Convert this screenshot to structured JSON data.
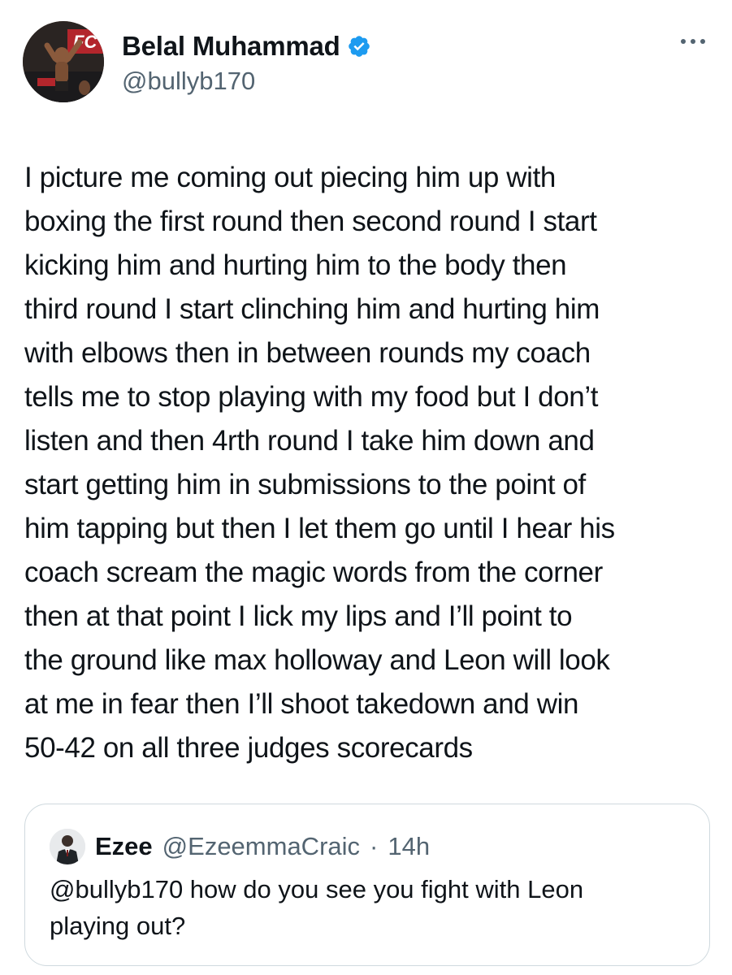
{
  "author": {
    "display_name": "Belal Muhammad",
    "handle": "@bullyb170",
    "verified": true,
    "avatar_icon": "fighter-photo-avatar",
    "verified_color": "#1d9bf0"
  },
  "menu": {
    "icon": "more-horizontal-icon"
  },
  "tweet": {
    "lines": [
      "I picture me coming out piecing him up with",
      "boxing the first round then second round I start",
      "kicking him and hurting him to the body then",
      "third round I start clinching him and hurting him",
      "with elbows then in between rounds my coach",
      "tells me to stop playing with my food but I don’t",
      "listen and then 4rth round I take him down and",
      "start getting him in submissions to the point of",
      "him tapping but then I let them go until I hear his",
      "coach scream the magic words from the corner",
      "then at that point I lick my lips and I’ll point to",
      "the ground like max holloway and Leon will look",
      "at me in fear then I’ll shoot takedown and win",
      "50-42 on all three judges scorecards"
    ]
  },
  "quote": {
    "display_name": "Ezee",
    "handle": "@EzeemmaCraic",
    "separator": "·",
    "time": "14h",
    "avatar_icon": "person-in-suit-avatar",
    "lines": [
      "@bullyb170 how do you see you fight with Leon",
      "playing out?"
    ]
  },
  "colors": {
    "text": "#0f1419",
    "secondary": "#536471",
    "border": "#cfd9de",
    "verified": "#1d9bf0"
  }
}
